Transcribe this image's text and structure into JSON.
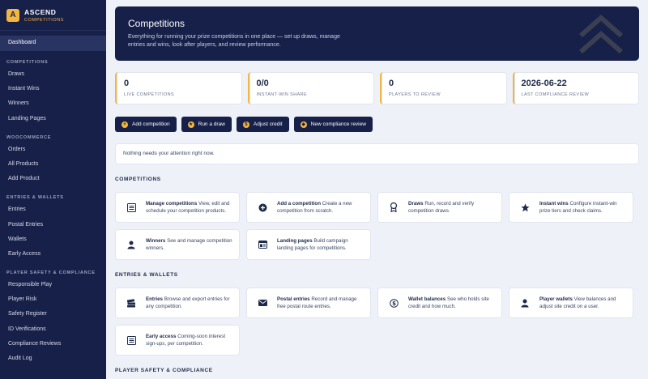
{
  "brand": {
    "title": "ASCEND",
    "subtitle": "COMPETITIONS",
    "logo_letter": "A"
  },
  "sidebar": {
    "active": "Dashboard",
    "sections": [
      {
        "title": "COMPETITIONS",
        "items": [
          "Draws",
          "Instant Wins",
          "Winners",
          "Landing Pages"
        ]
      },
      {
        "title": "WOOCOMMERCE",
        "items": [
          "Orders",
          "All Products",
          "Add Product"
        ]
      },
      {
        "title": "ENTRIES & WALLETS",
        "items": [
          "Entries",
          "Postal Entries",
          "Wallets",
          "Early Access"
        ]
      },
      {
        "title": "PLAYER SAFETY & COMPLIANCE",
        "items": [
          "Responsible Play",
          "Player Risk",
          "Safety Register",
          "ID Verifications",
          "Compliance Reviews",
          "Audit Log"
        ]
      }
    ]
  },
  "hero": {
    "title": "Competitions",
    "description": "Everything for running your prize competitions in one place — set up draws, manage entries and wins, look after players, and review performance."
  },
  "stats": [
    {
      "value": "0",
      "label": "LIVE COMPETITIONS"
    },
    {
      "value": "0/0",
      "label": "INSTANT-WIN SHARE"
    },
    {
      "value": "0",
      "label": "PLAYERS TO REVIEW"
    },
    {
      "value": "2026-06-22",
      "label": "LAST COMPLIANCE REVIEW"
    }
  ],
  "actions": [
    {
      "label": "Add competition",
      "icon": "plus-icon"
    },
    {
      "label": "Run a draw",
      "icon": "award-icon"
    },
    {
      "label": "Adjust credit",
      "icon": "dollar-icon"
    },
    {
      "label": "New compliance review",
      "icon": "tag-icon"
    }
  ],
  "notice": "Nothing needs your attention right now.",
  "sections": [
    {
      "title": "COMPETITIONS",
      "cards": [
        {
          "title": "Manage competitions",
          "desc": "View, edit and schedule your competition products.",
          "icon": "list-icon"
        },
        {
          "title": "Add a competition",
          "desc": "Create a new competition from scratch.",
          "icon": "plus-circle-icon"
        },
        {
          "title": "Draws",
          "desc": "Run, record and verify competition draws.",
          "icon": "award-icon"
        },
        {
          "title": "Instant wins",
          "desc": "Configure instant-win prize tiers and check claims.",
          "icon": "star-icon"
        },
        {
          "title": "Winners",
          "desc": "See and manage competition winners.",
          "icon": "user-icon"
        },
        {
          "title": "Landing pages",
          "desc": "Build campaign landing pages for competitions.",
          "icon": "layout-icon"
        }
      ]
    },
    {
      "title": "ENTRIES & WALLETS",
      "cards": [
        {
          "title": "Entries",
          "desc": "Browse and export entries for any competition.",
          "icon": "tickets-icon"
        },
        {
          "title": "Postal entries",
          "desc": "Record and manage free postal route entries.",
          "icon": "envelope-icon"
        },
        {
          "title": "Wallet balances",
          "desc": "See who holds site credit and how much.",
          "icon": "dollar-icon"
        },
        {
          "title": "Player wallets",
          "desc": "View balances and adjust site credit on a user.",
          "icon": "user-icon"
        },
        {
          "title": "Early access",
          "desc": "Coming-soon interest sign-ups, per competition.",
          "icon": "list-icon"
        }
      ]
    },
    {
      "title": "PLAYER SAFETY & COMPLIANCE",
      "cards": []
    }
  ],
  "colors": {
    "navy": "#172048",
    "accent": "#f4b63f",
    "background": "#eef1f7"
  }
}
